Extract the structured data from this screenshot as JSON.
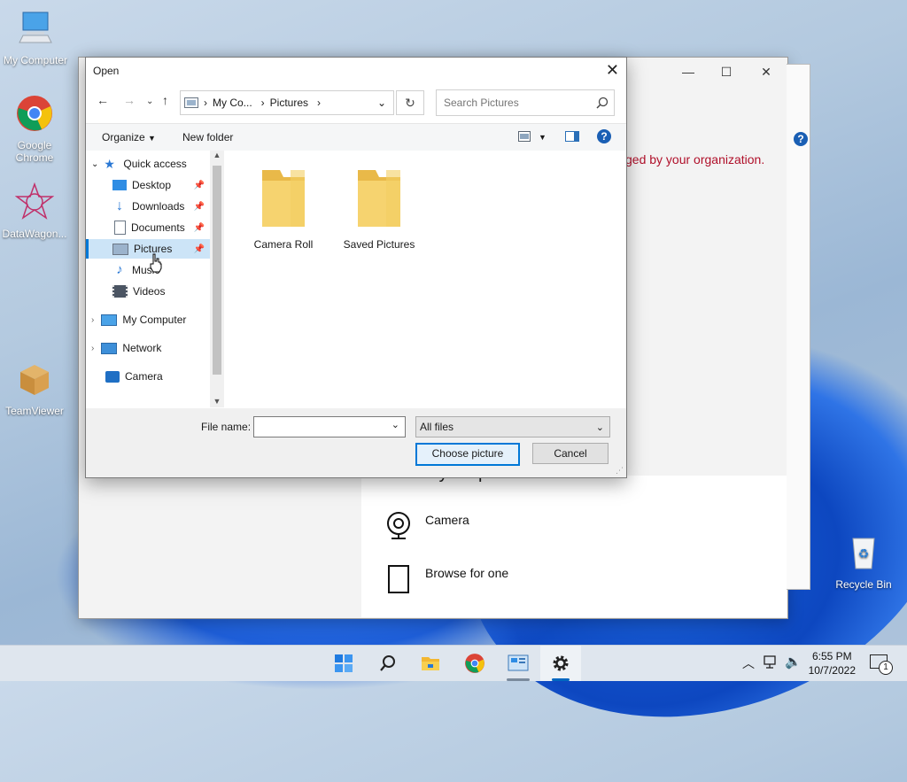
{
  "desktop": {
    "icons": [
      {
        "label": "My Computer"
      },
      {
        "label": "Google Chrome"
      },
      {
        "label": "DataWagon..."
      },
      {
        "label": "TeamViewer"
      },
      {
        "label": "Recycle Bin"
      }
    ]
  },
  "background_window": {
    "policy_text": "ged by your organization.",
    "section_title": "Create your picture",
    "options": [
      {
        "label": "Camera"
      },
      {
        "label": "Browse for one"
      }
    ]
  },
  "dialog": {
    "title": "Open",
    "address": {
      "segments": [
        "My Co...",
        "Pictures"
      ]
    },
    "search_placeholder": "Search Pictures",
    "toolbar": {
      "organize": "Organize",
      "new_folder": "New folder"
    },
    "nav": {
      "quick_access": "Quick access",
      "items": [
        {
          "label": "Desktop",
          "pinned": true
        },
        {
          "label": "Downloads",
          "pinned": true
        },
        {
          "label": "Documents",
          "pinned": true
        },
        {
          "label": "Pictures",
          "pinned": true,
          "selected": true
        },
        {
          "label": "Music",
          "pinned": false
        },
        {
          "label": "Videos",
          "pinned": false
        }
      ],
      "my_computer": "My Computer",
      "network": "Network",
      "camera": "Camera"
    },
    "folders": [
      {
        "label": "Camera Roll"
      },
      {
        "label": "Saved Pictures"
      }
    ],
    "file_name_label": "File name:",
    "file_name_value": "",
    "file_type": "All files",
    "choose_button": "Choose picture",
    "cancel_button": "Cancel"
  },
  "taskbar": {
    "time": "6:55 PM",
    "date": "10/7/2022",
    "notification_count": "1"
  },
  "colors": {
    "accent": "#0078d7",
    "policy_red": "#b0102a",
    "folder_yellow": "#f3cf63"
  }
}
